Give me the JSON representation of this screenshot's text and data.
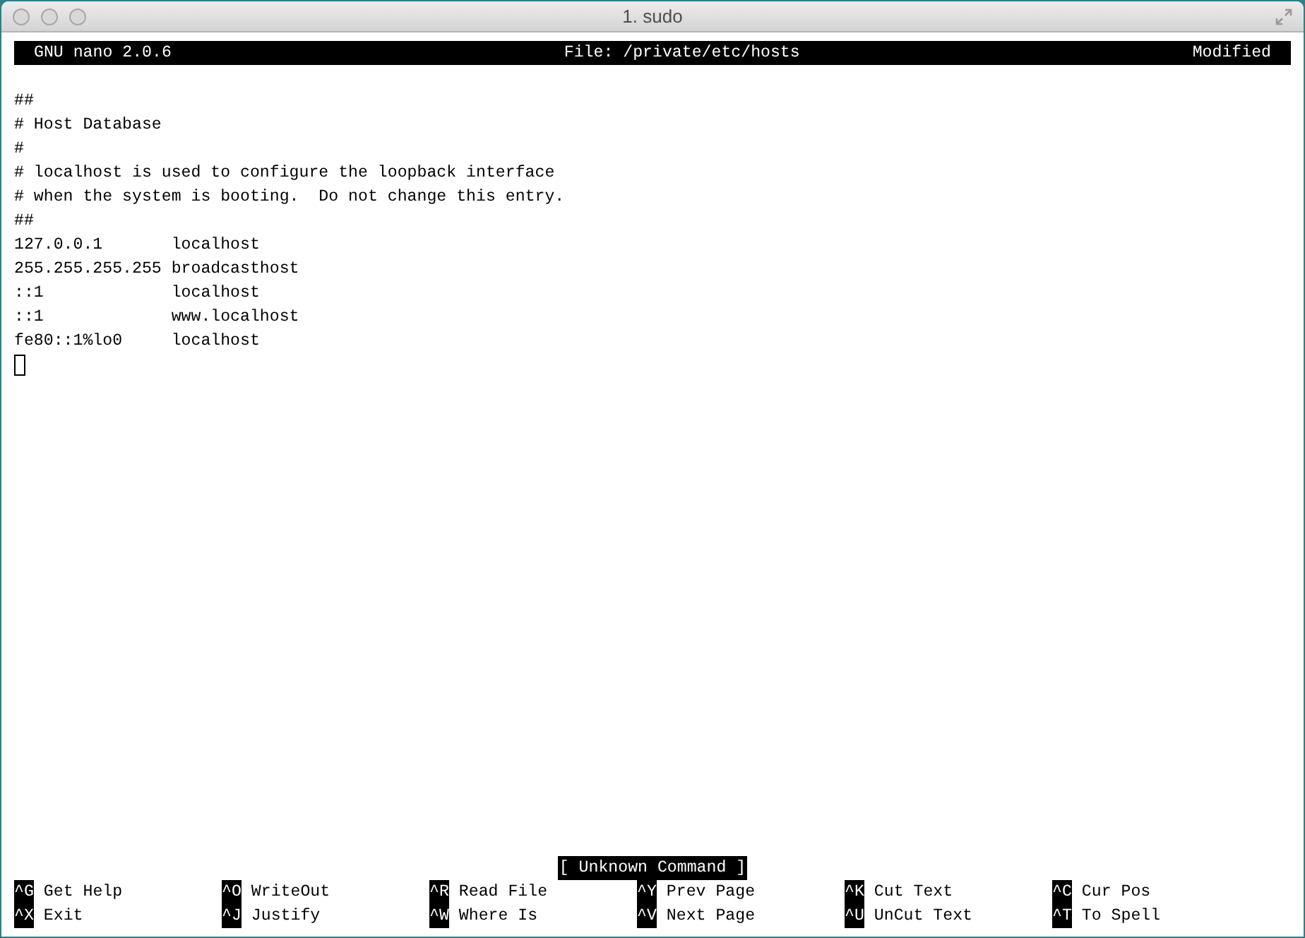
{
  "window": {
    "title": "1. sudo"
  },
  "header": {
    "app": "GNU nano 2.0.6",
    "file": "File: /private/etc/hosts",
    "status": "Modified"
  },
  "lines": [
    "##",
    "# Host Database",
    "#",
    "# localhost is used to configure the loopback interface",
    "# when the system is booting.  Do not change this entry.",
    "##",
    "127.0.0.1       localhost",
    "255.255.255.255 broadcasthost",
    "::1             localhost",
    "::1             www.localhost",
    "fe80::1%lo0     localhost"
  ],
  "status_message": "[ Unknown Command ]",
  "shortcuts": [
    {
      "key": "^G",
      "label": "Get Help"
    },
    {
      "key": "^O",
      "label": "WriteOut"
    },
    {
      "key": "^R",
      "label": "Read File"
    },
    {
      "key": "^Y",
      "label": "Prev Page"
    },
    {
      "key": "^K",
      "label": "Cut Text"
    },
    {
      "key": "^C",
      "label": "Cur Pos"
    },
    {
      "key": "^X",
      "label": "Exit"
    },
    {
      "key": "^J",
      "label": "Justify"
    },
    {
      "key": "^W",
      "label": "Where Is"
    },
    {
      "key": "^V",
      "label": "Next Page"
    },
    {
      "key": "^U",
      "label": "UnCut Text"
    },
    {
      "key": "^T",
      "label": "To Spell"
    }
  ]
}
